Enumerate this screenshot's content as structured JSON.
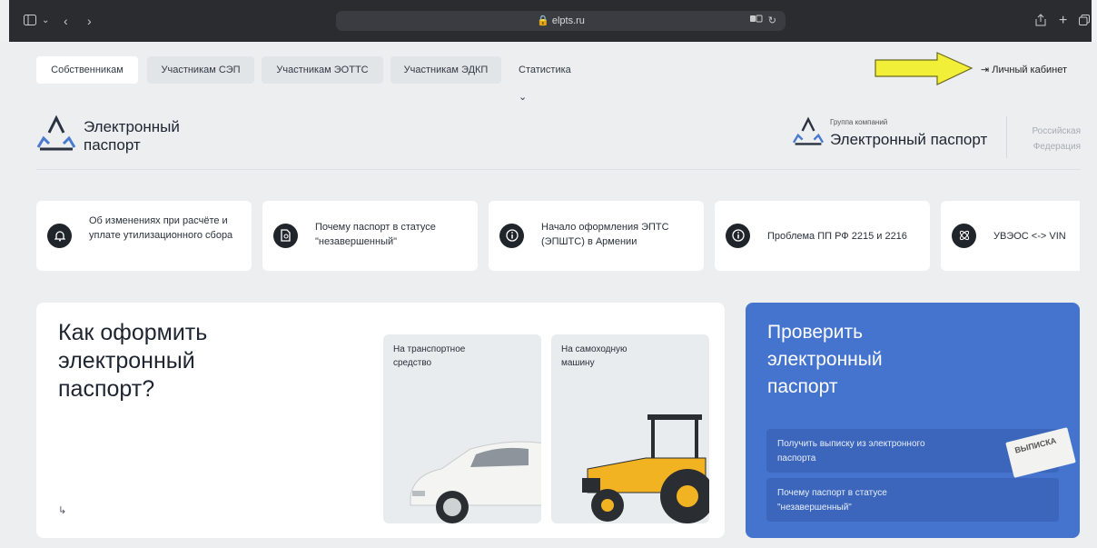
{
  "browser": {
    "url": "elpts.ru",
    "translate_icon": "translate-icon",
    "reload_icon": "reload-icon"
  },
  "nav": {
    "items": [
      {
        "label": "Собственникам",
        "active": true
      },
      {
        "label": "Участникам СЭП",
        "active": false
      },
      {
        "label": "Участникам ЭОТТС",
        "active": false
      },
      {
        "label": "Участникам ЭДКП",
        "active": false
      }
    ],
    "statistics": "Статистика ⌄",
    "cabinet": "⇥ Личный кабинет"
  },
  "logo": {
    "name_line1": "Электронный",
    "name_line2": "паспорт",
    "group_caption": "Группа компаний",
    "group_name": "Электронный паспорт",
    "region_line1": "Российская",
    "region_line2": "Федерация"
  },
  "notices": [
    {
      "icon": "bell-icon",
      "text": "Об изменениях при расчёте и уплате утилизационного сбора"
    },
    {
      "icon": "document-search-icon",
      "text": "Почему паспорт в статусе \"незавершенный\""
    },
    {
      "icon": "info-icon",
      "text": "Начало оформления ЭПТС (ЭПШТС) в Армении"
    },
    {
      "icon": "info-icon",
      "text": "Проблема ПП РФ 2215 и 2216"
    },
    {
      "icon": "atom-icon",
      "text": "УВЭОС <-> VIN"
    }
  ],
  "how": {
    "title": "Как оформить электронный паспорт?",
    "enter": "↳",
    "vehicle": "На транспортное средство",
    "machine": "На самоходную машину"
  },
  "check": {
    "title": "Проверить электронный паспорт",
    "extract": "Получить выписку из электронного паспорта",
    "status": "Почему паспорт в статусе \"незавершенный\"",
    "ticket": "ВЫПИСКА"
  },
  "colors": {
    "accent_blue": "#4574cf",
    "highlight_arrow": "#f2ef38"
  }
}
